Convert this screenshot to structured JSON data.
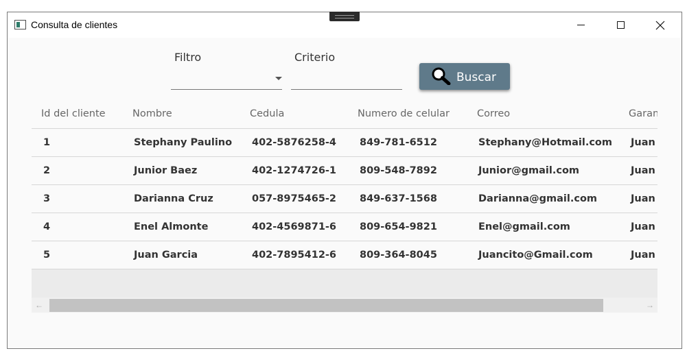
{
  "window": {
    "title": "Consulta de clientes",
    "icons": {
      "app": "app-window-icon",
      "minimize": "minimize-icon",
      "maximize": "maximize-icon",
      "close": "close-icon"
    },
    "close_glyph": "✕"
  },
  "filters": {
    "filtro_label": "Filtro",
    "filtro_value": "",
    "criterio_label": "Criterio",
    "criterio_value": "",
    "search_button_label": "Buscar",
    "search_icon": "magnifier-icon"
  },
  "table": {
    "columns": [
      "Id del cliente",
      "Nombre",
      "Cedula",
      "Numero de celular",
      "Correo",
      "Garan"
    ],
    "rows": [
      [
        "1",
        "Stephany Paulino",
        "402-5876258-4",
        "849-781-6512",
        "Stephany@Hotmail.com",
        "Juan"
      ],
      [
        "2",
        "Junior Baez",
        "402-1274726-1",
        "809-548-7892",
        "Junior@gmail.com",
        "Juan"
      ],
      [
        "3",
        "Darianna Cruz",
        "057-8975465-2",
        "849-637-1568",
        "Darianna@gmail.com",
        "Juan"
      ],
      [
        "4",
        "Enel Almonte",
        "402-4569871-6",
        "809-654-9821",
        "Enel@gmail.com",
        "Juan"
      ],
      [
        "5",
        "Juan Garcia",
        "402-7895412-6",
        "809-364-8045",
        "Juancito@Gmail.com",
        "Juan"
      ]
    ]
  },
  "scrollbar": {
    "left_arrow": "←",
    "right_arrow": "→"
  },
  "colors": {
    "button": "#5f7a8a",
    "window_bg": "#fafafa",
    "row_divider": "#d6d6d6"
  }
}
